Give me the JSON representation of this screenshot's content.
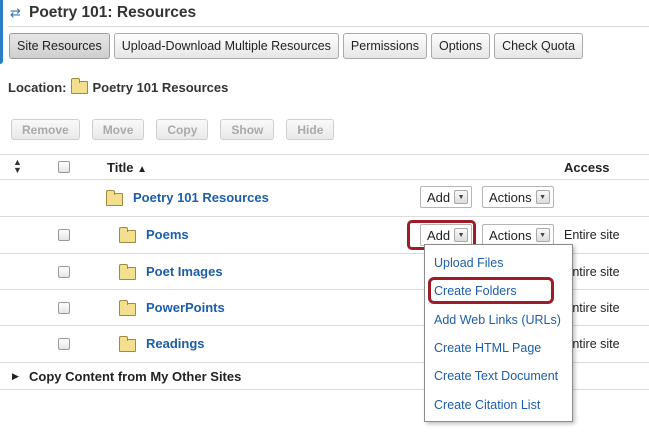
{
  "page": {
    "title": "Poetry 101: Resources"
  },
  "toolbar": {
    "tabs": [
      {
        "label": "Site Resources"
      },
      {
        "label": "Upload-Download Multiple Resources"
      },
      {
        "label": "Permissions"
      },
      {
        "label": "Options"
      },
      {
        "label": "Check Quota"
      }
    ],
    "active_tab": "Site Resources"
  },
  "location": {
    "label": "Location:",
    "folder": "Poetry 101 Resources"
  },
  "actions": {
    "remove": "Remove",
    "move": "Move",
    "copy": "Copy",
    "show": "Show",
    "hide": "Hide"
  },
  "table": {
    "headers": {
      "title": "Title",
      "access": "Access"
    },
    "root": {
      "name": "Poetry 101 Resources",
      "add": "Add",
      "actions": "Actions"
    },
    "rows": [
      {
        "name": "Poems",
        "access": "Entire site",
        "add": "Add",
        "actions": "Actions"
      },
      {
        "name": "Poet Images",
        "access": "Entire site"
      },
      {
        "name": "PowerPoints",
        "access": "Entire site"
      },
      {
        "name": "Readings",
        "access": "Entire site"
      }
    ]
  },
  "add_menu": {
    "items": [
      {
        "label": "Upload Files"
      },
      {
        "label": "Create Folders"
      },
      {
        "label": "Add Web Links (URLs)"
      },
      {
        "label": "Create HTML Page"
      },
      {
        "label": "Create Text Document"
      },
      {
        "label": "Create Citation List"
      }
    ],
    "highlighted": "Create Folders"
  },
  "footer": {
    "copy_content": "Copy Content from My Other Sites"
  },
  "colors": {
    "link": "#1c5ea9",
    "highlight": "#9e1c28",
    "folder": "#f3df8e"
  }
}
